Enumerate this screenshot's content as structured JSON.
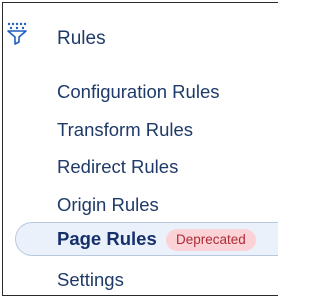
{
  "header": {
    "title": "Rules",
    "icon": "funnel-filter-icon"
  },
  "nav": {
    "items": [
      {
        "label": "Configuration Rules"
      },
      {
        "label": "Transform Rules"
      },
      {
        "label": "Redirect Rules"
      },
      {
        "label": "Origin Rules"
      },
      {
        "label": "Page Rules",
        "badge": "Deprecated",
        "active": true
      },
      {
        "label": "Settings"
      }
    ]
  },
  "colors": {
    "text": "#1f3a68",
    "active_background": "#eaf1fb",
    "active_border": "#b9c8df",
    "badge_background": "#fbd3d6",
    "badge_text": "#b02a37"
  }
}
